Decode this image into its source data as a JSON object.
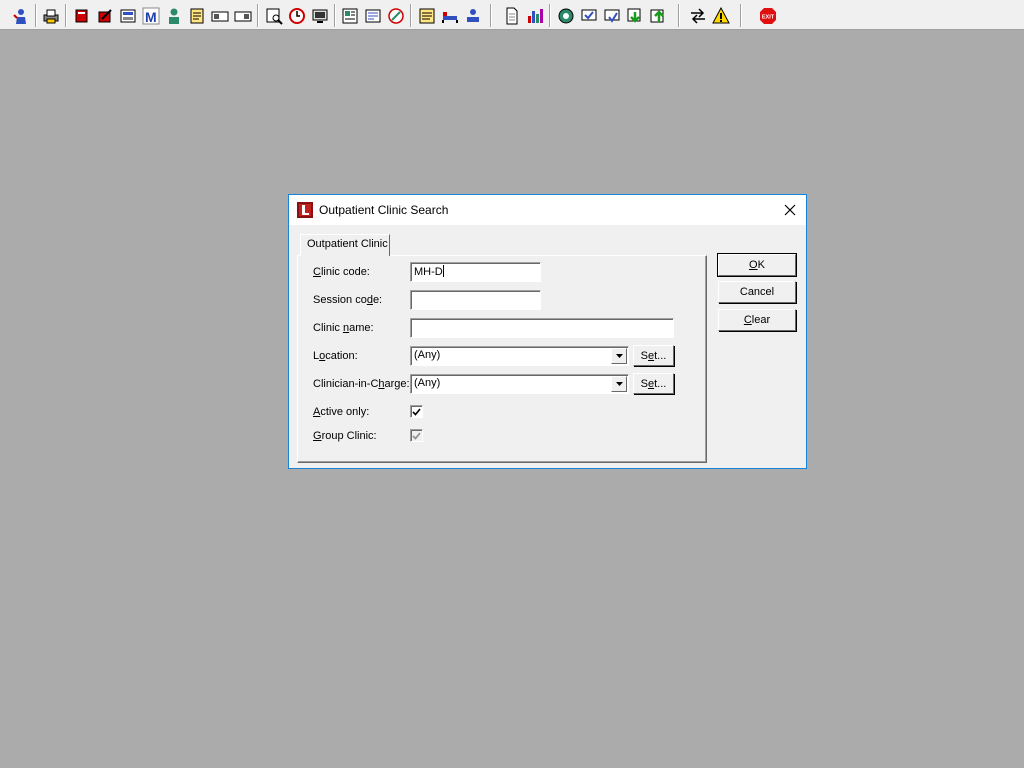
{
  "toolbar": {
    "icons": [
      "patient-icon",
      "print-icon",
      "book-icon",
      "edit-icon",
      "register-icon",
      "m-icon",
      "person-icon",
      "notes-icon",
      "card-icon",
      "card2-icon",
      "search-doc-icon",
      "clock-icon",
      "monitor-icon",
      "report-icon",
      "note-icon",
      "globe-icon",
      "sticky-icon",
      "bed-icon",
      "transfer-icon",
      "document-icon",
      "chart-icon",
      "network-icon",
      "check-icon",
      "flag-icon",
      "download-icon",
      "upload-icon",
      "swap-icon",
      "warning-icon",
      "exit-icon"
    ],
    "exit_label": "EXIT"
  },
  "dialog": {
    "title": "Outpatient Clinic Search",
    "tab_label": "Outpatient Clinic",
    "fields": {
      "clinic_code": {
        "label_pre": "",
        "label_u": "C",
        "label_post": "linic code:",
        "value": "MH-D"
      },
      "session_code": {
        "label_pre": "Session co",
        "label_u": "d",
        "label_post": "e:",
        "value": ""
      },
      "clinic_name": {
        "label_pre": "Clinic ",
        "label_u": "n",
        "label_post": "ame:",
        "value": ""
      },
      "location": {
        "label_pre": "L",
        "label_u": "o",
        "label_post": "cation:",
        "value": "(Any)",
        "set_pre": "S",
        "set_u": "e",
        "set_post": "t..."
      },
      "clinician": {
        "label_pre": "Clinician-in-C",
        "label_u": "h",
        "label_post": "arge:",
        "value": "(Any)",
        "set_pre": "S",
        "set_u": "e",
        "set_post": "t..."
      },
      "active_only": {
        "label_pre": "",
        "label_u": "A",
        "label_post": "ctive only:",
        "checked": true
      },
      "group_clinic": {
        "label_pre": "",
        "label_u": "G",
        "label_post": "roup Clinic:",
        "checked": true,
        "disabled": true
      }
    },
    "buttons": {
      "ok_pre": "",
      "ok_u": "O",
      "ok_post": "K",
      "cancel": "Cancel",
      "clear_pre": "",
      "clear_u": "C",
      "clear_post": "lear"
    }
  }
}
